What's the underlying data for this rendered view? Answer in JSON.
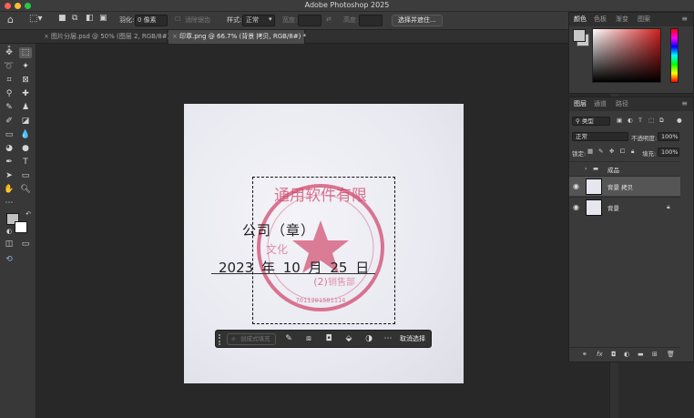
{
  "app": {
    "title": "Adobe Photoshop 2025"
  },
  "colors": {
    "close": "#fe5f57",
    "minimize": "#febc2e",
    "zoom": "#28c840",
    "accent": "#d21f1f"
  },
  "options": {
    "feather_label": "羽化:",
    "feather_value": "0 像素",
    "antialias_label": "消除锯齿",
    "style_label": "样式:",
    "style_value": "正常",
    "width_label": "宽度:",
    "height_label": "高度:",
    "select_mask_button": "选择并遮住..."
  },
  "tabs": [
    {
      "label": "图片分层.psd @ 50% (图层 2, RGB/8#)",
      "close": "×"
    },
    {
      "label": "印章.png @ 66.7% (背景 拷贝, RGB/8#) *",
      "close": "×"
    }
  ],
  "document": {
    "line1": "公司（章）",
    "date": "2023 年 10 月 25 日",
    "seal_top": "通用软件有限",
    "seal_left": "文化",
    "seal_bottom": "(2)",
    "seal_bottom2": "销售部",
    "seal_number": "7011201581114"
  },
  "context_bar": {
    "generative_fill": "创成式填充",
    "deselect": "取消选择",
    "icons": [
      "brush-icon",
      "select-subject-icon",
      "mask-icon",
      "fill-icon",
      "adjust-icon",
      "more-icon"
    ]
  },
  "color_panel": {
    "tabs": [
      "颜色",
      "色板",
      "渐变",
      "图案"
    ],
    "active": "颜色"
  },
  "layers_panel": {
    "tabs": [
      "图层",
      "通道",
      "路径"
    ],
    "filter_label": "类型",
    "blend_mode": "正常",
    "opacity_label": "不透明度:",
    "opacity_value": "100%",
    "lock_label": "锁定:",
    "fill_label": "填充:",
    "fill_value": "100%",
    "layers": [
      {
        "name": "成品",
        "type": "group",
        "visible": false,
        "selected": false
      },
      {
        "name": "背景 拷贝",
        "type": "layer",
        "visible": true,
        "selected": true
      },
      {
        "name": "背景",
        "type": "layer",
        "visible": true,
        "selected": false,
        "locked": true
      }
    ]
  }
}
